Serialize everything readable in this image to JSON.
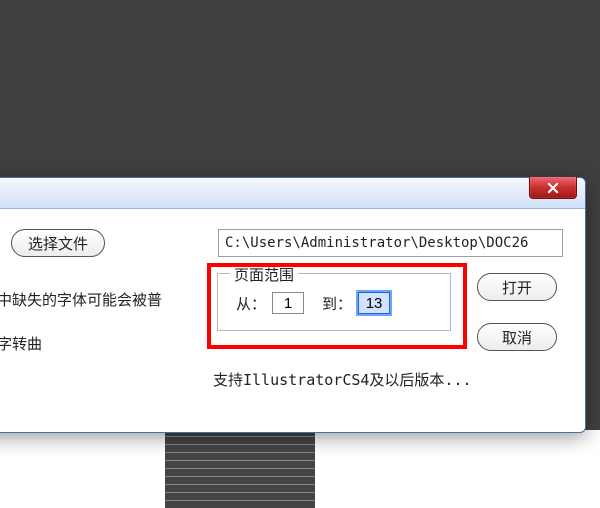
{
  "buttons": {
    "select_file": "选择文件",
    "open": "打开",
    "cancel": "取消"
  },
  "file_path": "C:\\Users\\Administrator\\Desktop\\DOC26",
  "hints": {
    "missing_fonts_line1": "中缺失的字体可能会被普",
    "missing_fonts_line2": "字转曲"
  },
  "page_range": {
    "legend": "页面范围",
    "from_label": "从：",
    "from_value": "1",
    "to_label": "到：",
    "to_value": "13"
  },
  "support_text": "支持IllustratorCS4及以后版本..."
}
